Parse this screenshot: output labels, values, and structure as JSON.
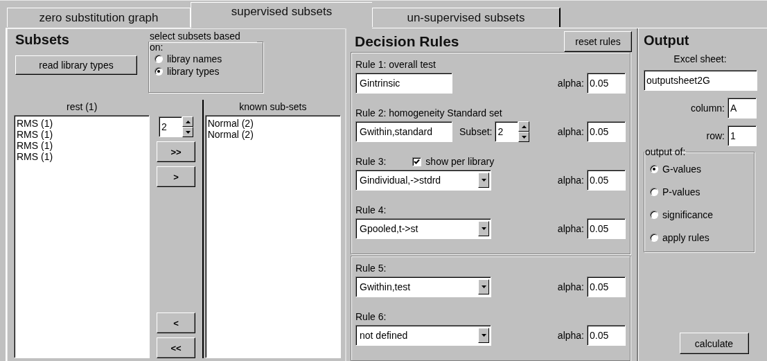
{
  "tabs": [
    {
      "label": "zero substitution graph",
      "selected": false
    },
    {
      "label": "supervised subsets",
      "selected": true
    },
    {
      "label": "un-supervised subsets",
      "selected": false
    }
  ],
  "subsets": {
    "title": "Subsets",
    "read_button": "read library types",
    "selection_group": {
      "label": "select subsets based on:",
      "options": [
        {
          "label": "libray names",
          "selected": false
        },
        {
          "label": "library types",
          "selected": true
        }
      ]
    },
    "rest_list": {
      "label": "rest (1)",
      "items": [
        "RMS (1)",
        "RMS (1)",
        "RMS (1)",
        "RMS (1)"
      ]
    },
    "spinner_value": "2",
    "move_buttons_top": [
      ">>",
      ">"
    ],
    "move_buttons_bottom": [
      "<",
      "<<"
    ],
    "known_list": {
      "label": "known sub-sets",
      "items": [
        "Normal (2)",
        "Normal (2)"
      ]
    }
  },
  "decision_rules": {
    "title": "Decision Rules",
    "reset_button": "reset rules",
    "groups": [
      {
        "rules": [
          {
            "label": "Rule 1: overall test",
            "kind": "text",
            "value": "Gintrinsic",
            "alpha_label": "alpha:",
            "alpha": "0.05"
          },
          {
            "label": "Rule 2: homogeneity Standard set",
            "kind": "text",
            "value": "Gwithin,standard",
            "subset": {
              "label": "Subset:",
              "value": "2"
            },
            "alpha_label": "alpha:",
            "alpha": "0.05"
          },
          {
            "label": "Rule 3:",
            "kind": "dropdown",
            "value": "Gindividual,->stdrd",
            "checkbox": {
              "label": "show per library",
              "checked": true
            },
            "alpha_label": "alpha:",
            "alpha": "0.05"
          },
          {
            "label": "Rule 4:",
            "kind": "dropdown",
            "value": "Gpooled,t->st",
            "alpha_label": "alpha:",
            "alpha": "0.05"
          }
        ]
      },
      {
        "rules": [
          {
            "label": "Rule 5:",
            "kind": "dropdown",
            "value": "Gwithin,test",
            "alpha_label": "alpha:",
            "alpha": "0.05"
          },
          {
            "label": "Rule 6:",
            "kind": "dropdown",
            "value": "not defined",
            "alpha_label": "alpha:",
            "alpha": "0.05"
          }
        ]
      }
    ]
  },
  "output": {
    "title": "Output",
    "sheet_label": "Excel sheet:",
    "sheet": "outputsheet2G",
    "column_label": "column:",
    "column": "A",
    "row_label": "row:",
    "row": "1",
    "output_group": {
      "label": "output of:",
      "options": [
        {
          "label": "G-values",
          "selected": true
        },
        {
          "label": "P-values",
          "selected": false
        },
        {
          "label": "significance",
          "selected": false
        },
        {
          "label": "apply rules",
          "selected": false
        }
      ]
    },
    "calculate_button": "calculate"
  }
}
